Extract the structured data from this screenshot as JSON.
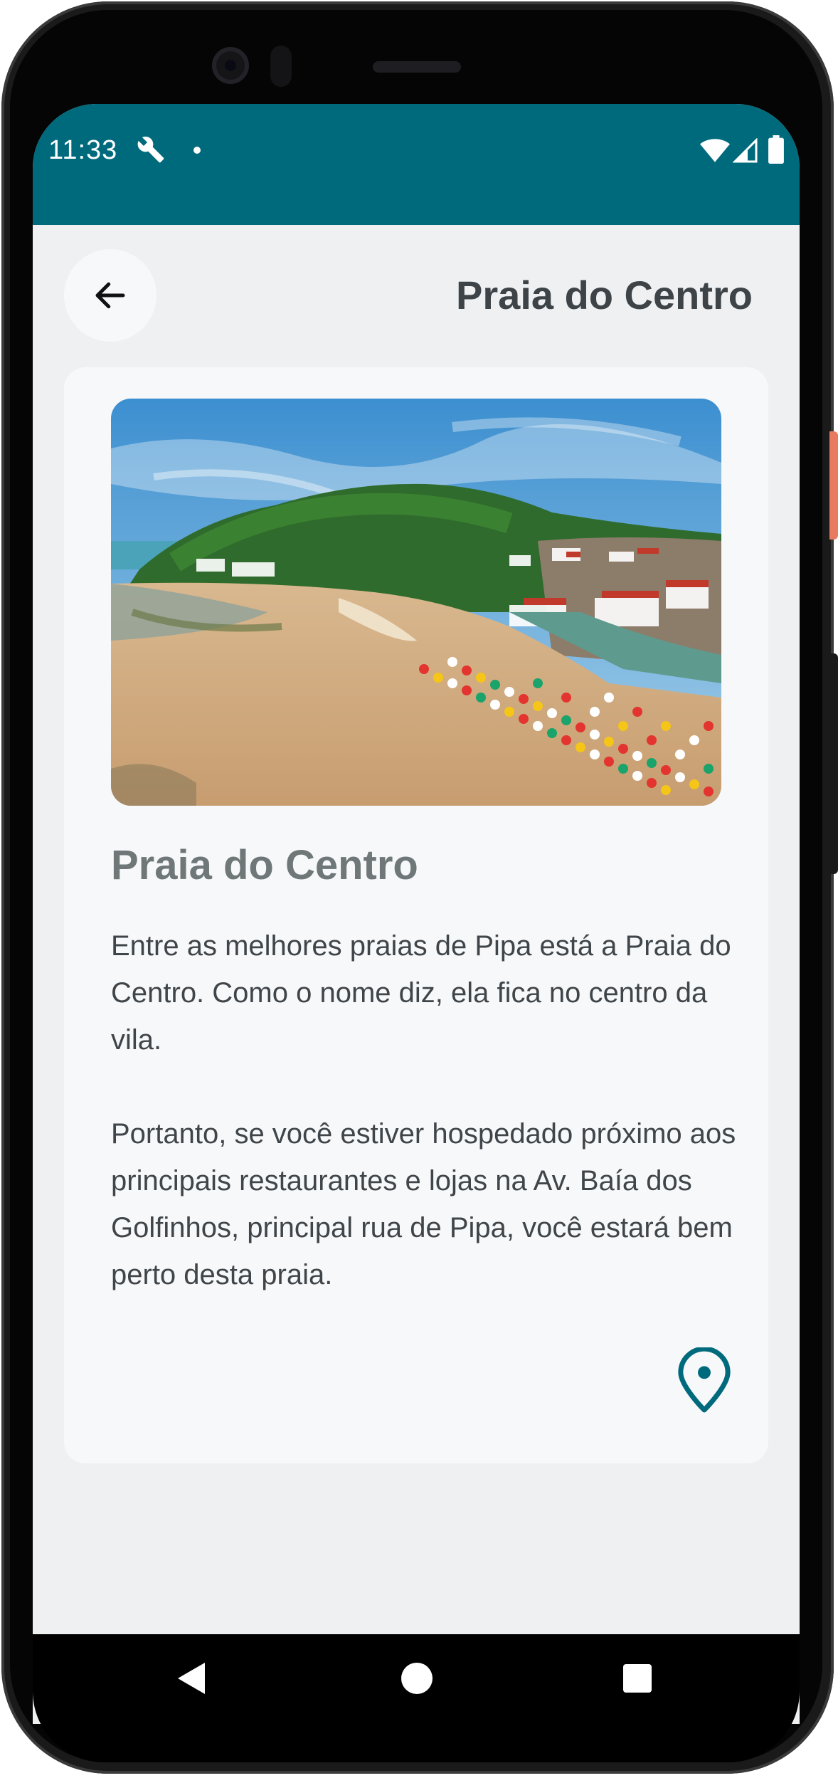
{
  "status_bar": {
    "time": "11:33",
    "icons": [
      "wrench-icon",
      "notification-dot-icon",
      "wifi-icon",
      "signal-icon",
      "battery-icon"
    ],
    "background_color": "#006a7d"
  },
  "app_bar": {
    "title": "Praia do Centro",
    "back_icon": "arrow-left-icon"
  },
  "card": {
    "image_alt": "beach-photo",
    "title": "Praia do Centro",
    "paragraphs": [
      "Entre as melhores praias de Pipa está a Praia do Centro. Como o nome diz, ela fica no centro da vila.",
      "Portanto, se você estiver hospedado próximo aos principais restaurantes e lojas na Av. Baía dos Golfinhos, principal rua de Pipa, você estará bem perto desta praia."
    ],
    "location_icon": "map-pin-icon",
    "accent_color": "#006a7d"
  },
  "nav_bar": {
    "buttons": [
      "back-triangle-icon",
      "home-circle-icon",
      "recents-square-icon"
    ]
  }
}
